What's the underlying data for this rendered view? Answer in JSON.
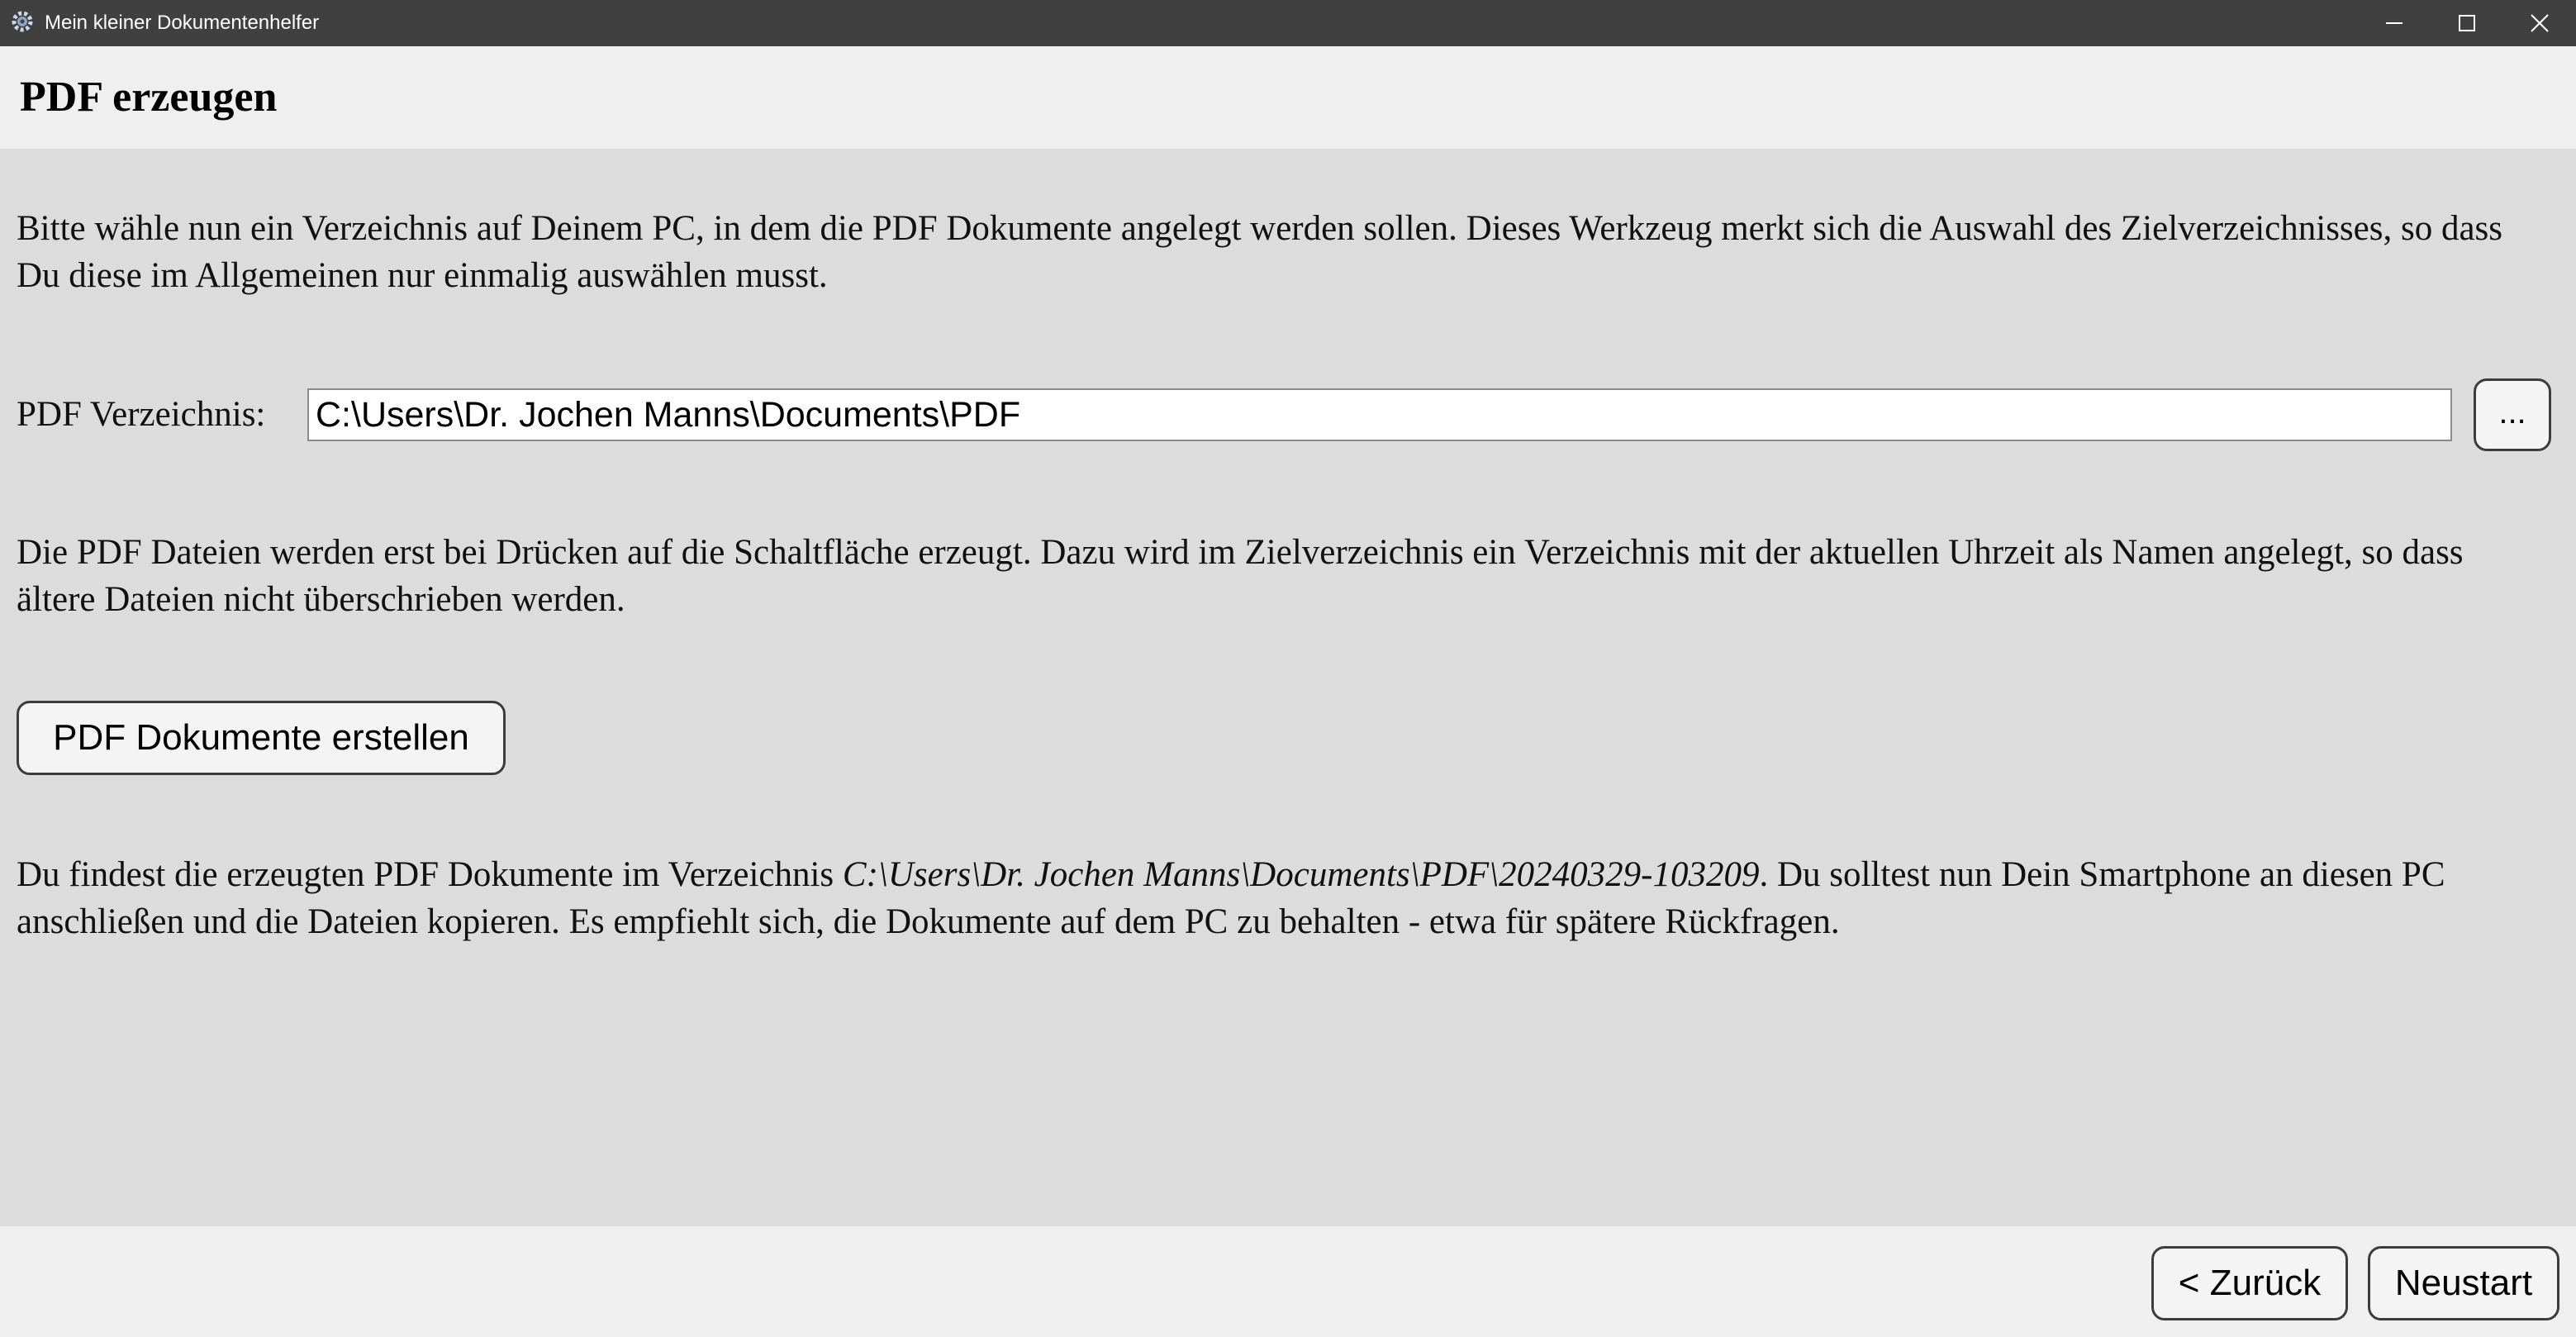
{
  "window": {
    "title": "Mein kleiner Dokumentenhelfer",
    "app_icon": "gear-icon",
    "controls": [
      "minimize-icon",
      "maximize-icon",
      "close-icon"
    ]
  },
  "header": {
    "title": "PDF erzeugen"
  },
  "main": {
    "intro_text": "Bitte wähle nun ein Verzeichnis auf Deinem PC, in dem die PDF Dokumente angelegt werden sollen. Dieses Werkzeug merkt sich die Auswahl des Zielverzeichnisses, so dass Du diese im Allgemeinen nur einmalig auswählen musst.",
    "directory_label": "PDF Verzeichnis:",
    "directory_value": "C:\\Users\\Dr. Jochen Manns\\Documents\\PDF",
    "browse_label": "...",
    "info_text": "Die PDF Dateien werden erst bei Drücken auf die Schaltfläche erzeugt. Dazu wird im Zielverzeichnis ein Verzeichnis mit der aktuellen Uhrzeit als Namen angelegt, so dass ältere Dateien nicht überschrieben werden.",
    "create_button": "PDF Dokumente erstellen",
    "result_prefix": "Du findest die erzeugten PDF Dokumente im Verzeichnis ",
    "result_path": "C:\\Users\\Dr. Jochen Manns\\Documents\\PDF\\20240329-103209",
    "result_suffix": ". Du solltest nun Dein Smartphone an diesen PC anschließen und die Dateien kopieren. Es empfiehlt sich, die Dokumente auf dem PC zu behalten - etwa für spätere Rückfragen."
  },
  "footer": {
    "back_button": "< Zurück",
    "restart_button": "Neustart"
  },
  "colors": {
    "titlebar": "#404040",
    "header_bg": "#efefef",
    "content_bg": "#dcdcdc",
    "button_border": "#3c3c3c"
  }
}
